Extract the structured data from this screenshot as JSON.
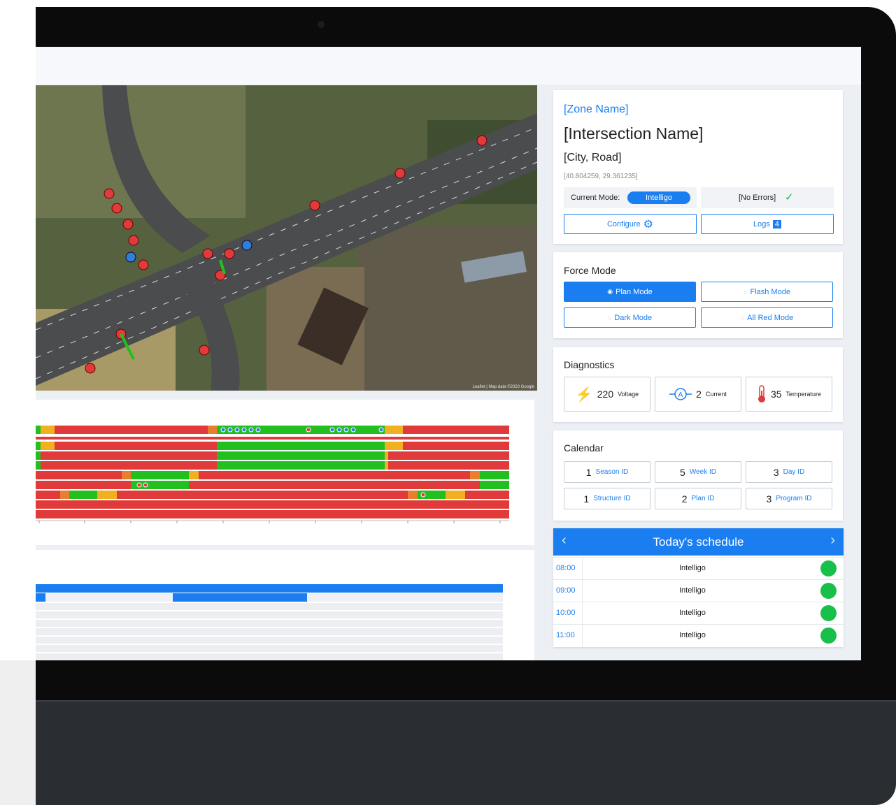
{
  "zone": {
    "zone_name": "[Zone Name]",
    "intersection_name": "[Intersection Name]",
    "location": "[City, Road]",
    "coordinates": "[40.804259, 29.361235]",
    "current_mode_label": "Current Mode:",
    "current_mode_value": "Intelligo",
    "errors_text": "[No Errors]",
    "configure_label": "Configure",
    "logs_label": "Logs",
    "logs_count": "4"
  },
  "force_mode": {
    "title": "Force Mode",
    "options": [
      "Plan Mode",
      "Flash Mode",
      "Dark Mode",
      "All Red Mode"
    ],
    "selected": "Plan Mode"
  },
  "diagnostics": {
    "title": "Diagnostics",
    "voltage": {
      "value": "220",
      "label": "Voltage"
    },
    "current": {
      "value": "2",
      "label": "Current"
    },
    "temperature": {
      "value": "35",
      "label": "Temperature"
    }
  },
  "calendar": {
    "title": "Calendar",
    "items": [
      {
        "value": "1",
        "label": "Season ID"
      },
      {
        "value": "5",
        "label": "Week ID"
      },
      {
        "value": "3",
        "label": "Day ID"
      },
      {
        "value": "1",
        "label": "Structure ID"
      },
      {
        "value": "2",
        "label": "Plan ID"
      },
      {
        "value": "3",
        "label": "Program ID"
      }
    ]
  },
  "schedule": {
    "title": "Today's schedule",
    "prev_icon": "chevron-left",
    "next_icon": "chevron-right",
    "rows": [
      {
        "time": "08:00",
        "mode": "Intelligo"
      },
      {
        "time": "09:00",
        "mode": "Intelligo"
      },
      {
        "time": "10:00",
        "mode": "Intelligo"
      },
      {
        "time": "11:00",
        "mode": "Intelligo"
      }
    ]
  },
  "map": {
    "attribution": "Leaflet | Map data ©2020 Google"
  },
  "colors": {
    "accent": "#1a7ef0",
    "signal_red": "#e03a3a",
    "signal_green": "#22c01f",
    "signal_amber": "#f0b020",
    "status_ok": "#18c04a"
  }
}
